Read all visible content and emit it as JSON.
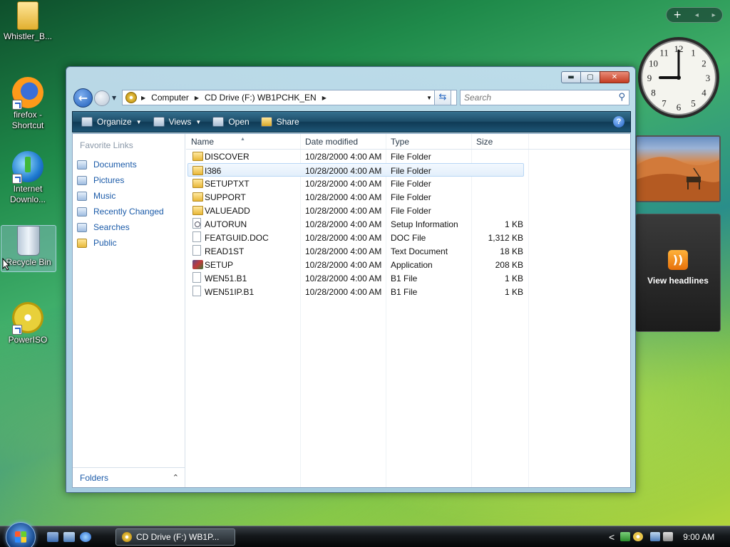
{
  "desktop": {
    "icons": [
      {
        "label": "Whistler_B..."
      },
      {
        "label": "firefox - Shortcut"
      },
      {
        "label": "Internet Downlo..."
      },
      {
        "label": "Recycle Bin"
      },
      {
        "label": "PowerISO"
      }
    ]
  },
  "gadgets": {
    "clock": {
      "hour": 9,
      "minute": 0,
      "numbers": [
        "12",
        "1",
        "2",
        "3",
        "4",
        "5",
        "6",
        "7",
        "8",
        "9",
        "10",
        "11"
      ]
    },
    "feeds": {
      "label": "View headlines"
    },
    "bar": {
      "add_label": "+",
      "prev": "◂",
      "next": "▸"
    }
  },
  "explorer": {
    "title": "CD Drive (F:) WB1PCHK_EN",
    "controls": {
      "minimize": "▬",
      "maximize": "▢",
      "close": "✕"
    },
    "address": {
      "crumbs": [
        "Computer",
        "CD Drive (F:) WB1PCHK_EN"
      ]
    },
    "search": {
      "placeholder": "Search"
    },
    "toolbar": {
      "organize": "Organize",
      "views": "Views",
      "open": "Open",
      "share": "Share",
      "help": "?"
    },
    "nav": {
      "title": "Favorite Links",
      "items": [
        {
          "label": "Documents"
        },
        {
          "label": "Pictures"
        },
        {
          "label": "Music"
        },
        {
          "label": "Recently Changed"
        },
        {
          "label": "Searches"
        },
        {
          "label": "Public"
        }
      ],
      "folders_label": "Folders"
    },
    "columns": [
      "Name",
      "Date modified",
      "Type",
      "Size"
    ],
    "files": [
      {
        "name": "DISCOVER",
        "date": "10/28/2000 4:00 AM",
        "type": "File Folder",
        "size": "",
        "icon": "folder-icon"
      },
      {
        "name": "I386",
        "date": "10/28/2000 4:00 AM",
        "type": "File Folder",
        "size": "",
        "icon": "folder-icon"
      },
      {
        "name": "SETUPTXT",
        "date": "10/28/2000 4:00 AM",
        "type": "File Folder",
        "size": "",
        "icon": "folder-icon"
      },
      {
        "name": "SUPPORT",
        "date": "10/28/2000 4:00 AM",
        "type": "File Folder",
        "size": "",
        "icon": "folder-icon"
      },
      {
        "name": "VALUEADD",
        "date": "10/28/2000 4:00 AM",
        "type": "File Folder",
        "size": "",
        "icon": "folder-icon"
      },
      {
        "name": "AUTORUN",
        "date": "10/28/2000 4:00 AM",
        "type": "Setup Information",
        "size": "1 KB",
        "icon": "setup-info-icon"
      },
      {
        "name": "FEATGUID.DOC",
        "date": "10/28/2000 4:00 AM",
        "type": "DOC File",
        "size": "1,312 KB",
        "icon": "document-icon"
      },
      {
        "name": "READ1ST",
        "date": "10/28/2000 4:00 AM",
        "type": "Text Document",
        "size": "18 KB",
        "icon": "document-icon"
      },
      {
        "name": "SETUP",
        "date": "10/28/2000 4:00 AM",
        "type": "Application",
        "size": "208 KB",
        "icon": "application-icon"
      },
      {
        "name": "WEN51.B1",
        "date": "10/28/2000 4:00 AM",
        "type": "B1 File",
        "size": "1 KB",
        "icon": "document-icon"
      },
      {
        "name": "WEN51IP.B1",
        "date": "10/28/2000 4:00 AM",
        "type": "B1 File",
        "size": "1 KB",
        "icon": "document-icon"
      }
    ]
  },
  "taskbar": {
    "task_label": "CD Drive (F:) WB1P...",
    "time": "9:00 AM",
    "tray_chevron": "<"
  }
}
